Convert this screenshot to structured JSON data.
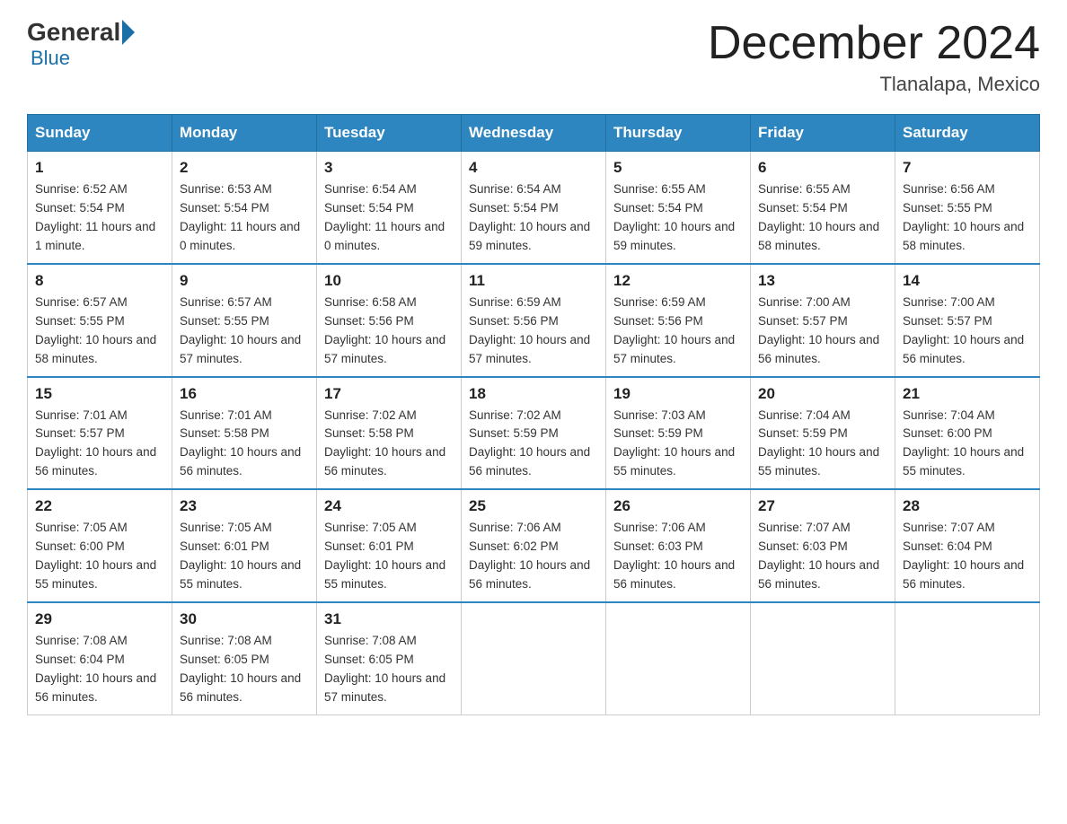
{
  "header": {
    "logo_general": "General",
    "logo_blue": "Blue",
    "month_title": "December 2024",
    "location": "Tlanalapa, Mexico"
  },
  "weekdays": [
    "Sunday",
    "Monday",
    "Tuesday",
    "Wednesday",
    "Thursday",
    "Friday",
    "Saturday"
  ],
  "weeks": [
    [
      {
        "day": "1",
        "sunrise": "6:52 AM",
        "sunset": "5:54 PM",
        "daylight": "11 hours and 1 minute."
      },
      {
        "day": "2",
        "sunrise": "6:53 AM",
        "sunset": "5:54 PM",
        "daylight": "11 hours and 0 minutes."
      },
      {
        "day": "3",
        "sunrise": "6:54 AM",
        "sunset": "5:54 PM",
        "daylight": "11 hours and 0 minutes."
      },
      {
        "day": "4",
        "sunrise": "6:54 AM",
        "sunset": "5:54 PM",
        "daylight": "10 hours and 59 minutes."
      },
      {
        "day": "5",
        "sunrise": "6:55 AM",
        "sunset": "5:54 PM",
        "daylight": "10 hours and 59 minutes."
      },
      {
        "day": "6",
        "sunrise": "6:55 AM",
        "sunset": "5:54 PM",
        "daylight": "10 hours and 58 minutes."
      },
      {
        "day": "7",
        "sunrise": "6:56 AM",
        "sunset": "5:55 PM",
        "daylight": "10 hours and 58 minutes."
      }
    ],
    [
      {
        "day": "8",
        "sunrise": "6:57 AM",
        "sunset": "5:55 PM",
        "daylight": "10 hours and 58 minutes."
      },
      {
        "day": "9",
        "sunrise": "6:57 AM",
        "sunset": "5:55 PM",
        "daylight": "10 hours and 57 minutes."
      },
      {
        "day": "10",
        "sunrise": "6:58 AM",
        "sunset": "5:56 PM",
        "daylight": "10 hours and 57 minutes."
      },
      {
        "day": "11",
        "sunrise": "6:59 AM",
        "sunset": "5:56 PM",
        "daylight": "10 hours and 57 minutes."
      },
      {
        "day": "12",
        "sunrise": "6:59 AM",
        "sunset": "5:56 PM",
        "daylight": "10 hours and 57 minutes."
      },
      {
        "day": "13",
        "sunrise": "7:00 AM",
        "sunset": "5:57 PM",
        "daylight": "10 hours and 56 minutes."
      },
      {
        "day": "14",
        "sunrise": "7:00 AM",
        "sunset": "5:57 PM",
        "daylight": "10 hours and 56 minutes."
      }
    ],
    [
      {
        "day": "15",
        "sunrise": "7:01 AM",
        "sunset": "5:57 PM",
        "daylight": "10 hours and 56 minutes."
      },
      {
        "day": "16",
        "sunrise": "7:01 AM",
        "sunset": "5:58 PM",
        "daylight": "10 hours and 56 minutes."
      },
      {
        "day": "17",
        "sunrise": "7:02 AM",
        "sunset": "5:58 PM",
        "daylight": "10 hours and 56 minutes."
      },
      {
        "day": "18",
        "sunrise": "7:02 AM",
        "sunset": "5:59 PM",
        "daylight": "10 hours and 56 minutes."
      },
      {
        "day": "19",
        "sunrise": "7:03 AM",
        "sunset": "5:59 PM",
        "daylight": "10 hours and 55 minutes."
      },
      {
        "day": "20",
        "sunrise": "7:04 AM",
        "sunset": "5:59 PM",
        "daylight": "10 hours and 55 minutes."
      },
      {
        "day": "21",
        "sunrise": "7:04 AM",
        "sunset": "6:00 PM",
        "daylight": "10 hours and 55 minutes."
      }
    ],
    [
      {
        "day": "22",
        "sunrise": "7:05 AM",
        "sunset": "6:00 PM",
        "daylight": "10 hours and 55 minutes."
      },
      {
        "day": "23",
        "sunrise": "7:05 AM",
        "sunset": "6:01 PM",
        "daylight": "10 hours and 55 minutes."
      },
      {
        "day": "24",
        "sunrise": "7:05 AM",
        "sunset": "6:01 PM",
        "daylight": "10 hours and 55 minutes."
      },
      {
        "day": "25",
        "sunrise": "7:06 AM",
        "sunset": "6:02 PM",
        "daylight": "10 hours and 56 minutes."
      },
      {
        "day": "26",
        "sunrise": "7:06 AM",
        "sunset": "6:03 PM",
        "daylight": "10 hours and 56 minutes."
      },
      {
        "day": "27",
        "sunrise": "7:07 AM",
        "sunset": "6:03 PM",
        "daylight": "10 hours and 56 minutes."
      },
      {
        "day": "28",
        "sunrise": "7:07 AM",
        "sunset": "6:04 PM",
        "daylight": "10 hours and 56 minutes."
      }
    ],
    [
      {
        "day": "29",
        "sunrise": "7:08 AM",
        "sunset": "6:04 PM",
        "daylight": "10 hours and 56 minutes."
      },
      {
        "day": "30",
        "sunrise": "7:08 AM",
        "sunset": "6:05 PM",
        "daylight": "10 hours and 56 minutes."
      },
      {
        "day": "31",
        "sunrise": "7:08 AM",
        "sunset": "6:05 PM",
        "daylight": "10 hours and 57 minutes."
      },
      null,
      null,
      null,
      null
    ]
  ]
}
